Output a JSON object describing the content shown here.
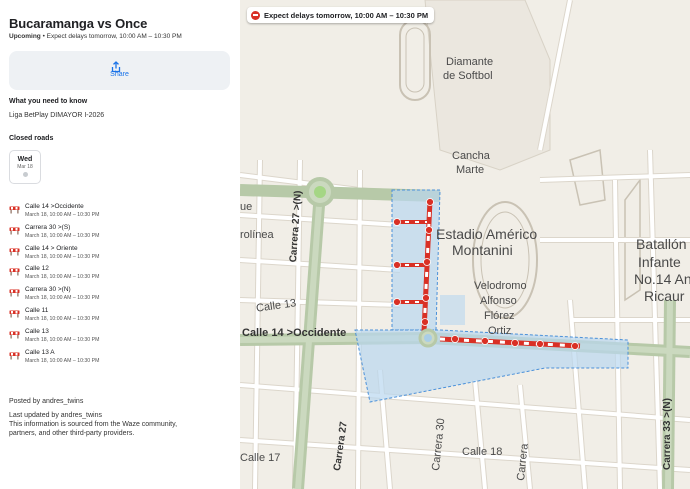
{
  "panel": {
    "title": "Bucaramanga vs Once",
    "status": "Upcoming",
    "status_detail": " • Expect delays tomorrow, 10:00 AM – 10:30 PM",
    "share_label": "Share",
    "know_heading": "What you need to know",
    "know_text": "Liga BetPlay DIMAYOR I-2026",
    "closed_heading": "Closed roads",
    "date": {
      "day": "Wed",
      "month_day": "Mar 18"
    },
    "roads": [
      {
        "name": "Calle 14 >Occidente",
        "time": "March 18, 10:00 AM – 10:30 PM"
      },
      {
        "name": "Carrera 30 >(S)",
        "time": "March 18, 10:00 AM – 10:30 PM"
      },
      {
        "name": "Calle 14 > Oriente",
        "time": "March 18, 10:00 AM – 10:30 PM"
      },
      {
        "name": "Calle 12",
        "time": "March 18, 10:00 AM – 10:30 PM"
      },
      {
        "name": "Carrera 30 >(N)",
        "time": "March 18, 10:00 AM – 10:30 PM"
      },
      {
        "name": "Calle 11",
        "time": "March 18, 10:00 AM – 10:30 PM"
      },
      {
        "name": "Calle 13",
        "time": "March 18, 10:00 AM – 10:30 PM"
      },
      {
        "name": "Calle 13 A",
        "time": "March 18, 10:00 AM – 10:30 PM"
      }
    ],
    "posted_by": "Posted by andres_twins",
    "last_updated": "Last updated by andres_twins",
    "source_line1": "This information is sourced from the Waze community,",
    "source_line2": "partners, and other third-party providers."
  },
  "map": {
    "banner": "Expect delays tomorrow, 10:00 AM – 10:30 PM",
    "labels": {
      "diamante": "Diamante",
      "softbol": "de Softbol",
      "cancha": "Cancha",
      "marte": "Marte",
      "estadio1": "Estadio Américo",
      "estadio2": "Montanini",
      "velodromo1": "Velodromo",
      "velodromo2": "Alfonso",
      "velodromo3": "Flórez",
      "velodromo4": "Ortiz",
      "batallon1": "Batallón",
      "batallon2": "Infante",
      "batallon3": "No.14 An",
      "batallon4": "Ricaur",
      "ue": "ue",
      "colinea": "rolínea",
      "calle13": "Calle 13",
      "calle14": "Calle 14 >Occidente",
      "carrera27n": "Carrera 27 >(N)",
      "carrera27": "Carrera 27",
      "carrera30": "Carrera 30",
      "carrera33": "Carrera 33 >(N)",
      "calle17": "Calle 17",
      "calle18": "Calle 18",
      "carrera": "Carrera"
    },
    "colors": {
      "closure_red": "#d93025",
      "zone_fill": "#b9d7f0",
      "zone_stroke": "#4a90d9",
      "arterial": "#b7c9a8",
      "background": "#f1eee7"
    }
  },
  "icons": {
    "share": "share-icon",
    "road_closed": "road-closed-icon",
    "banner": "no-entry-icon"
  }
}
